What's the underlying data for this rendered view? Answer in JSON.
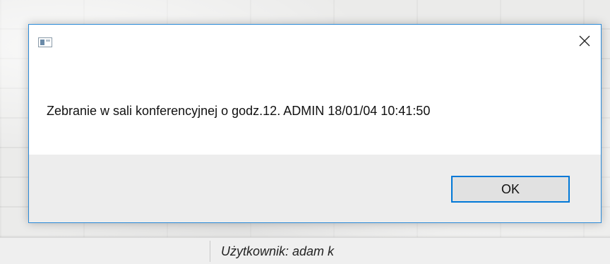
{
  "dialog": {
    "icon": "app-window-icon",
    "close_icon": "close-icon",
    "message": "Zebranie w sali konferencyjnej o godz.12. ADMIN 18/01/04 10:41:50",
    "ok_label": "OK",
    "accent_color": "#0078d7"
  },
  "statusbar": {
    "user_text": "Użytkownik: adam k"
  }
}
